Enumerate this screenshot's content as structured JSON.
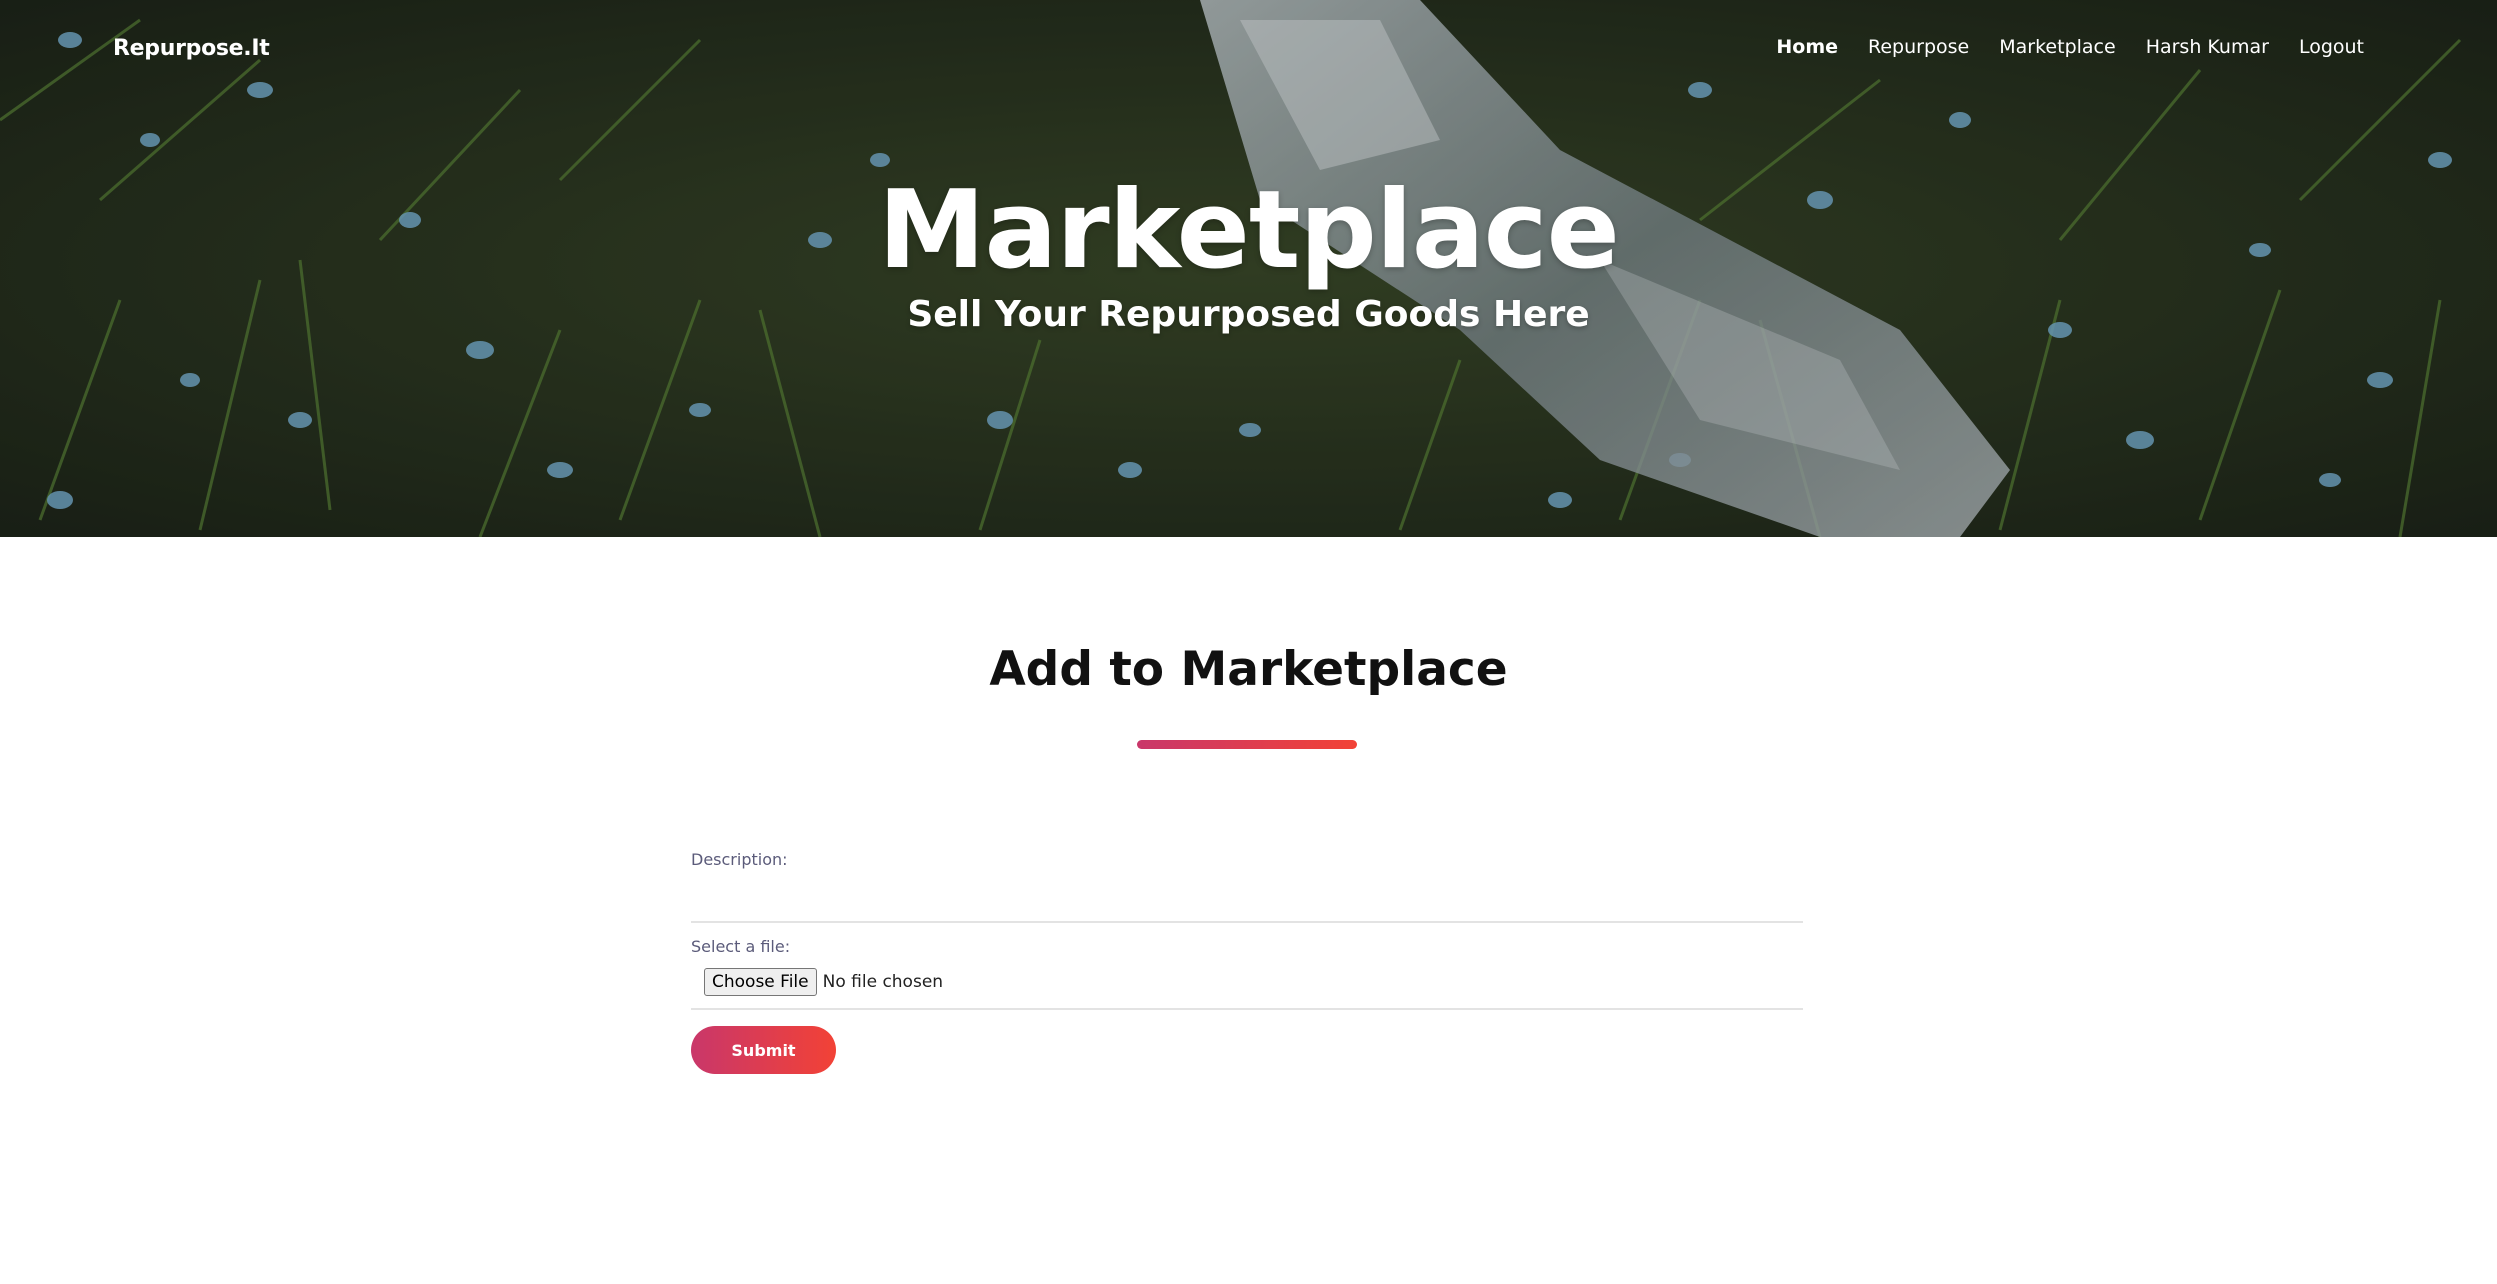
{
  "brand": "Repurpose.It",
  "nav": {
    "home": "Home",
    "repurpose": "Repurpose",
    "marketplace": "Marketplace",
    "user": "Harsh Kumar",
    "logout": "Logout"
  },
  "hero": {
    "title": "Marketplace",
    "subtitle": "Sell Your Repurposed Goods Here"
  },
  "section": {
    "title": "Add to Marketplace"
  },
  "form": {
    "description_label": "Description:",
    "description_value": "",
    "file_label": "Select a file:",
    "choose_file": "Choose File",
    "file_status": "No file chosen",
    "submit": "Submit"
  },
  "colors": {
    "accent_start": "#c9376a",
    "accent_end": "#f24236"
  }
}
